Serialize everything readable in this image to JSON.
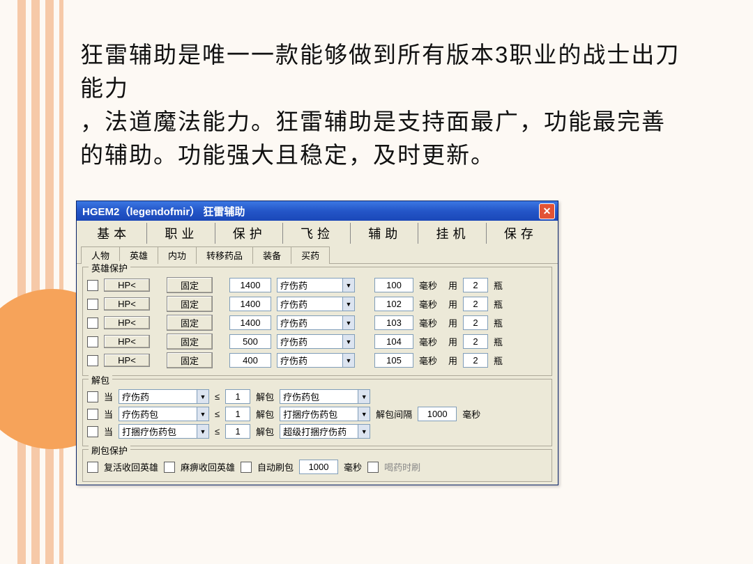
{
  "caption": "狂雷辅助是唯一一款能够做到所有版本3职业的战士出刀能力\n，法道魔法能力。狂雷辅助是支持面最广，功能最完善的辅助。功能强大且稳定，及时更新。",
  "window": {
    "title": "HGEM2（legendofmir） 狂雷辅助"
  },
  "main_tabs": [
    "基本",
    "职业",
    "保护",
    "飞捡",
    "辅助",
    "挂机",
    "保存"
  ],
  "sub_tabs": [
    "人物",
    "英雄",
    "内功",
    "转移药品",
    "装备",
    "买药"
  ],
  "active_sub": 1,
  "groups": {
    "hero_protect": "英雄保护",
    "unpack": "解包",
    "refresh_protect": "刷包保护"
  },
  "labels": {
    "hp": "HP<",
    "fixed": "固定",
    "ms": "毫秒",
    "use": "用",
    "bottle": "瓶",
    "when": "当",
    "le": "≤",
    "unpack": "解包",
    "unpack_interval": "解包间隔",
    "revive_recall": "复活收回英雄",
    "paralyze_recall": "麻痹收回英雄",
    "auto_refresh": "自动刷包",
    "drink_when_refresh": "喝药时刷"
  },
  "protect_rows": [
    {
      "val": "1400",
      "potion": "疗伤药",
      "delay": "100",
      "qty": "2"
    },
    {
      "val": "1400",
      "potion": "疗伤药",
      "delay": "102",
      "qty": "2"
    },
    {
      "val": "1400",
      "potion": "疗伤药",
      "delay": "103",
      "qty": "2"
    },
    {
      "val": "500",
      "potion": "疗伤药",
      "delay": "104",
      "qty": "2"
    },
    {
      "val": "400",
      "potion": "疗伤药",
      "delay": "105",
      "qty": "2"
    }
  ],
  "unpack_rows": [
    {
      "item": "疗伤药",
      "count": "1",
      "pack": "疗伤药包",
      "interval": null
    },
    {
      "item": "疗伤药包",
      "count": "1",
      "pack": "打捆疗伤药包",
      "interval": "1000"
    },
    {
      "item": "打捆疗伤药包",
      "count": "1",
      "pack": "超级打捆疗伤药",
      "interval": null
    }
  ],
  "refresh": {
    "interval": "1000"
  }
}
